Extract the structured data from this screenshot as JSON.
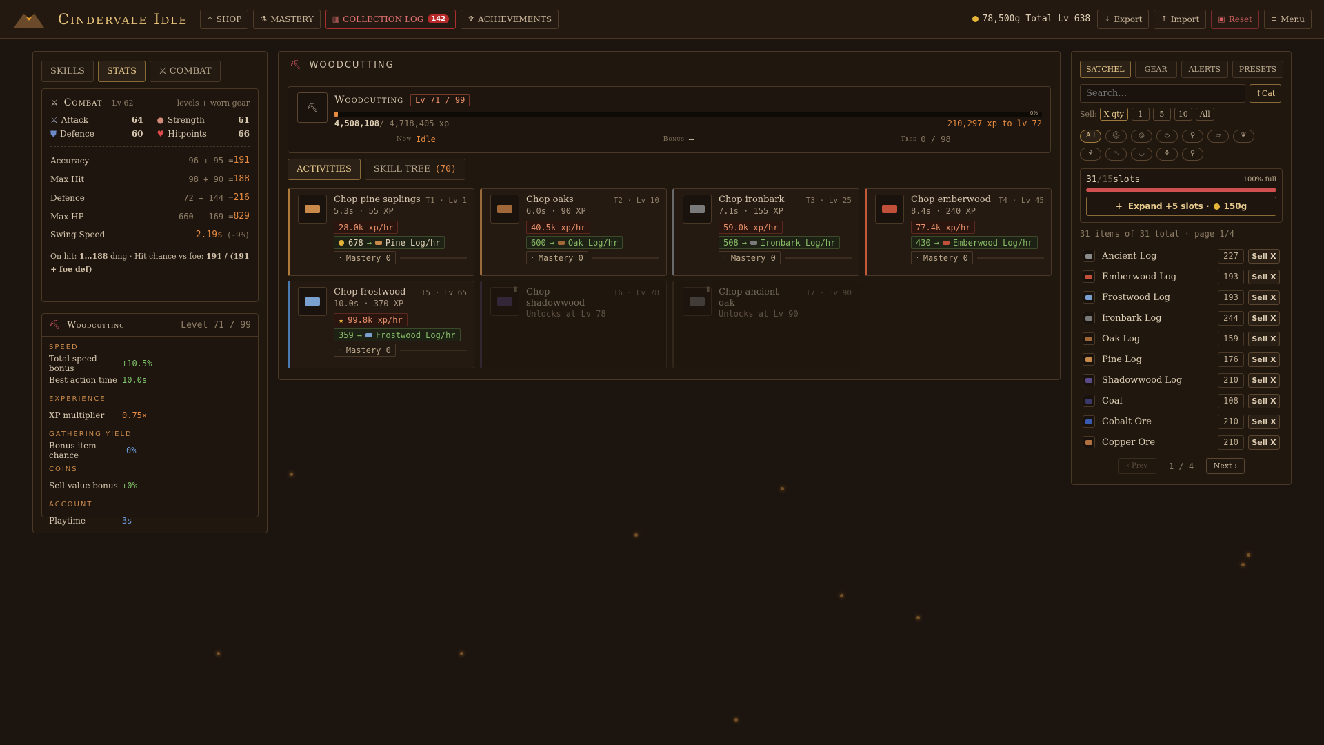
{
  "header": {
    "brand": "Cindervale Idle",
    "nav": {
      "shop": "SHOP",
      "mastery": "MASTERY",
      "collection": "COLLECTION LOG",
      "collection_count": "142",
      "achievements": "ACHIEVEMENTS"
    },
    "gold": "78,500g",
    "total_lv": "Total Lv 638",
    "export": "Export",
    "import": "Import",
    "reset": "Reset",
    "menu": "Menu"
  },
  "left": {
    "tabs": {
      "skills": "SKILLS",
      "stats": "STATS",
      "combat": "COMBAT"
    },
    "combat": {
      "title": "Combat",
      "level": "Lv 62",
      "note": "levels + worn gear",
      "attack_label": "Attack",
      "attack_val": "64",
      "strength_label": "Strength",
      "strength_val": "61",
      "defence_label": "Defence",
      "defence_val": "60",
      "hitpoints_label": "Hitpoints",
      "hitpoints_val": "66",
      "rows": [
        {
          "label": "Accuracy",
          "calc": "96 + 95 = ",
          "total": "191"
        },
        {
          "label": "Max Hit",
          "calc": "98 + 90 = ",
          "total": "188"
        },
        {
          "label": "Defence",
          "calc": "72 + 144 = ",
          "total": "216"
        },
        {
          "label": "Max HP",
          "calc": "660 + 169 = ",
          "total": "829"
        }
      ],
      "swing_label": "Swing Speed",
      "swing_val": "2.19s",
      "swing_pct": "(-9%)",
      "onhit_a": "On hit: ",
      "onhit_b": "1…188",
      "onhit_c": " dmg · Hit chance vs foe: ",
      "onhit_d": "191 / (191 + foe def)"
    },
    "skill": {
      "title": "Woodcutting",
      "level": "Level 71 / 99",
      "speed_head": "SPEED",
      "speed_bonus_label": "Total speed bonus",
      "speed_bonus_val": "+10.5%",
      "best_label": "Best action time",
      "best_val": "10.0s",
      "xp_head": "EXPERIENCE",
      "xp_label": "XP multiplier",
      "xp_val": "0.75×",
      "yield_head": "GATHERING YIELD",
      "yield_label": "Bonus item chance",
      "yield_val": "0%",
      "coins_head": "COINS",
      "coins_label": "Sell value bonus",
      "coins_val": "+0%",
      "account_head": "ACCOUNT",
      "play_label": "Playtime",
      "play_val": "3s"
    }
  },
  "center": {
    "section_title": "WOODCUTTING",
    "skill_name": "Woodcutting",
    "lv_badge": "Lv 71 / 99",
    "progress_pct_label": "0%",
    "progress_fraction": 0.005,
    "xp_current": "4,508,108",
    "xp_sep": " / 4,718,405 xp",
    "xp_to_next": "210,297 xp to lv 72",
    "now_label": "Now",
    "now_val": "Idle",
    "bonus_label": "Bonus",
    "bonus_val": "—",
    "tree_label": "Tree",
    "tree_val": "0 / 98",
    "tab_activities": "ACTIVITIES",
    "tab_tree": "SKILL TREE",
    "tab_tree_count": "(70)",
    "activities": [
      {
        "title": "Chop pine saplings",
        "tier": "T1 · Lv 1",
        "meta": "5.3s · 55 XP",
        "rate": "28.0k xp/hr",
        "yield_num": "678",
        "yield_item": "Pine Log/hr",
        "mastery": "Mastery 0",
        "accent": "#b07a3a",
        "log": "#c88a4a"
      },
      {
        "title": "Chop oaks",
        "tier": "T2 · Lv 10",
        "meta": "6.0s · 90 XP",
        "rate": "40.5k xp/hr",
        "yield_num": "600",
        "yield_item": "Oak Log/hr",
        "mastery": "Mastery 0",
        "accent": "#9a6a3a",
        "log": "#a06838"
      },
      {
        "title": "Chop ironbark",
        "tier": "T3 · Lv 25",
        "meta": "7.1s · 155 XP",
        "rate": "59.0k xp/hr",
        "yield_num": "508",
        "yield_item": "Ironbark Log/hr",
        "mastery": "Mastery 0",
        "accent": "#6a6a6a",
        "log": "#7a7a7a"
      },
      {
        "title": "Chop emberwood",
        "tier": "T4 · Lv 45",
        "meta": "8.4s · 240 XP",
        "rate": "77.4k xp/hr",
        "yield_num": "430",
        "yield_item": "Emberwood Log/hr",
        "mastery": "Mastery 0",
        "accent": "#c05a3a",
        "log": "#c0503a"
      },
      {
        "title": "Chop frostwood",
        "tier": "T5 · Lv 65",
        "meta": "10.0s · 370 XP",
        "rate": "99.8k xp/hr",
        "yield_num": "359",
        "yield_item": "Frostwood Log/hr",
        "mastery": "Mastery 0",
        "accent": "#4a7ab0",
        "log": "#7aa0d0"
      },
      {
        "title": "Chop shadowwood",
        "tier": "T6 · Lv 78",
        "meta": "Unlocks at Lv 78",
        "accent": "#4a3a5a",
        "log": "#4a3a6a",
        "locked": true
      },
      {
        "title": "Chop ancient oak",
        "tier": "T7 · Lv 90",
        "meta": "Unlocks at Lv 90",
        "accent": "#4a3a2a",
        "log": "#6a6a6a",
        "locked": true
      }
    ]
  },
  "right": {
    "tabs": {
      "satchel": "SATCHEL",
      "gear": "GEAR",
      "alerts": "ALERTS",
      "presets": "PRESETS"
    },
    "search_placeholder": "Search…",
    "cat_btn": "Cat",
    "sell_label": "Sell:",
    "sell_opts": [
      "X qty",
      "1",
      "5",
      "10",
      "All"
    ],
    "cat_all": "All",
    "slots_used": "31",
    "slots_sep": " / ",
    "slots_total": "15",
    "slots_word": " slots",
    "slots_full": "100% full",
    "expand_label": "Expand +5 slots ·",
    "expand_cost": "150g",
    "summary": "31 items of 31 total · page 1/4",
    "items": [
      {
        "name": "Ancient Log",
        "qty": "227",
        "color": "#8a8a8a"
      },
      {
        "name": "Emberwood Log",
        "qty": "193",
        "color": "#c0503a"
      },
      {
        "name": "Frostwood Log",
        "qty": "193",
        "color": "#7aa0d0"
      },
      {
        "name": "Ironbark Log",
        "qty": "244",
        "color": "#7a7a7a"
      },
      {
        "name": "Oak Log",
        "qty": "159",
        "color": "#a06838"
      },
      {
        "name": "Pine Log",
        "qty": "176",
        "color": "#c88a4a"
      },
      {
        "name": "Shadowwood Log",
        "qty": "210",
        "color": "#5a4a8a"
      },
      {
        "name": "Coal",
        "qty": "108",
        "color": "#3a3a6a"
      },
      {
        "name": "Cobalt Ore",
        "qty": "210",
        "color": "#3a5ab0"
      },
      {
        "name": "Copper Ore",
        "qty": "210",
        "color": "#b07040"
      }
    ],
    "sell_btn": "Sell X",
    "prev": "‹ Prev",
    "page": "1 / 4",
    "next": "Next ›"
  },
  "colors": {
    "accent": "#e8c47a",
    "danger": "#b82a2a",
    "bg": "#1c140e"
  }
}
